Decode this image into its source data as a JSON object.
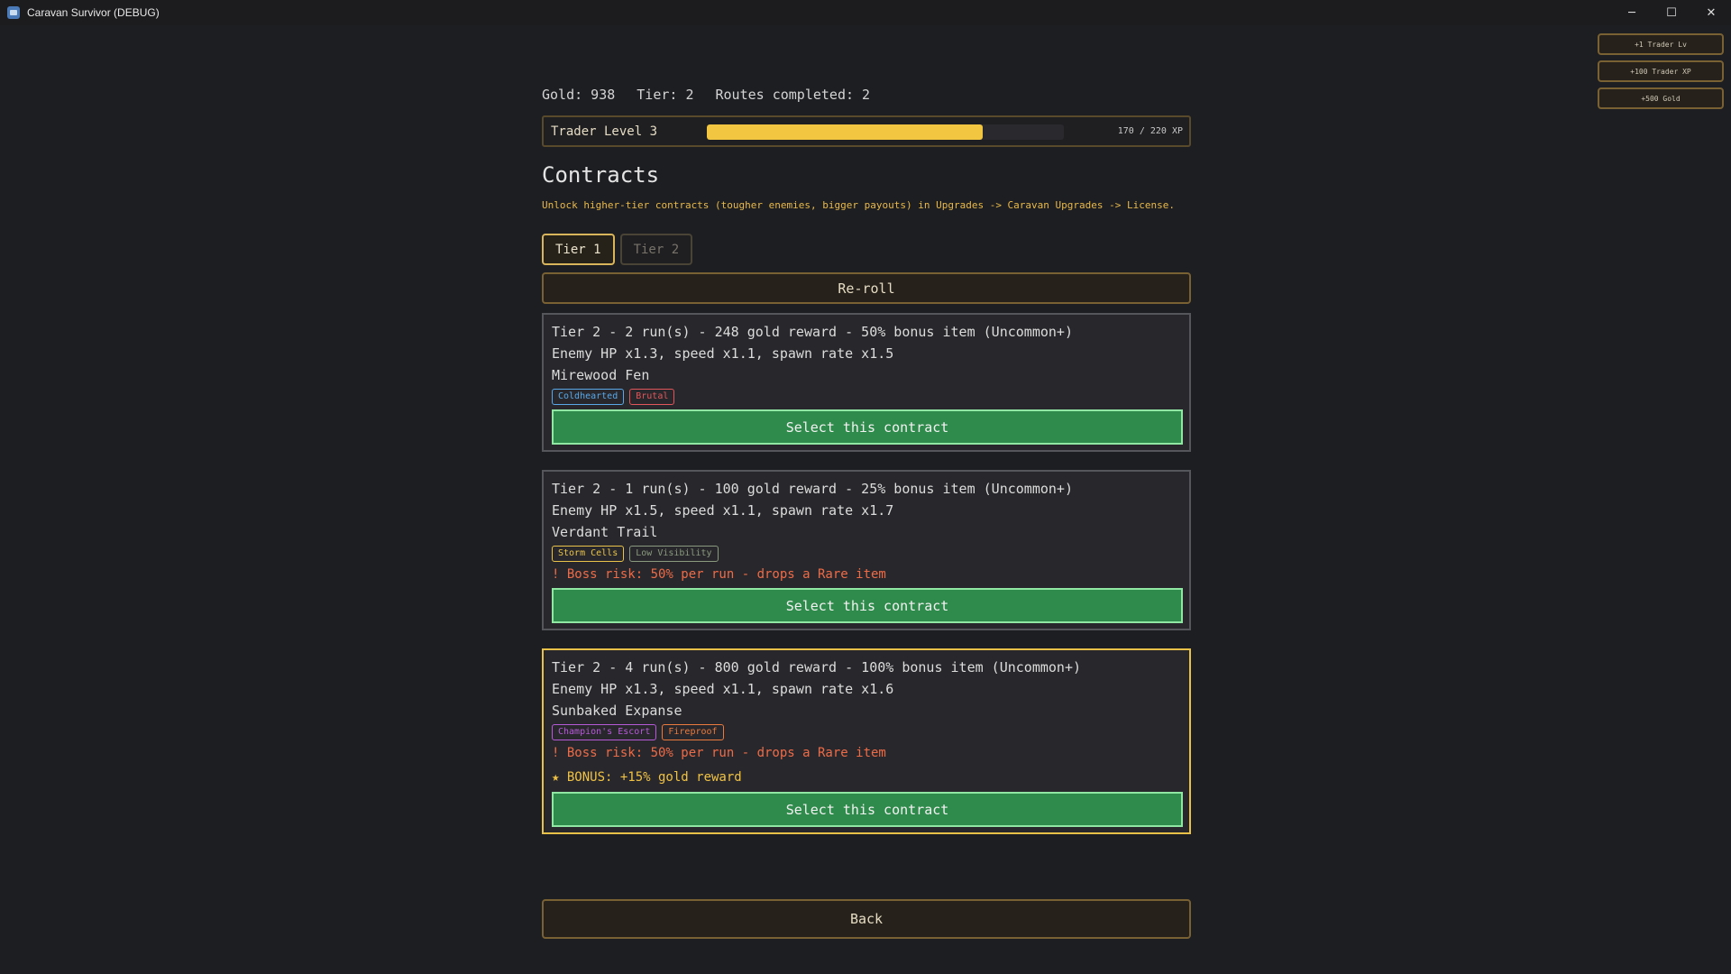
{
  "window": {
    "title": "Caravan Survivor (DEBUG)",
    "controls": {
      "minimize": "─",
      "maximize": "☐",
      "close": "✕"
    }
  },
  "debug_buttons": [
    "+1 Trader Lv",
    "+100 Trader XP",
    "+500 Gold"
  ],
  "stats": {
    "gold": "Gold: 938",
    "tier": "Tier: 2",
    "routes": "Routes completed: 2"
  },
  "trader": {
    "label": "Trader Level 3",
    "xp_text": "170 / 220 XP",
    "xp_current": 170,
    "xp_max": 220,
    "bar_color": "#f2c640"
  },
  "heading": "Contracts",
  "hint": "Unlock higher-tier contracts (tougher enemies, bigger payouts) in Upgrades -> Caravan Upgrades -> License.",
  "tabs": [
    {
      "label": "Tier 1",
      "active": true
    },
    {
      "label": "Tier 2",
      "active": false
    }
  ],
  "reroll_label": "Re-roll",
  "contracts": [
    {
      "summary": "Tier 2 - 2 run(s) - 248 gold reward - 50% bonus item (Uncommon+)",
      "modifiers": "Enemy HP x1.3, speed x1.1, spawn rate x1.5",
      "location": "Mirewood Fen",
      "tags": [
        {
          "label": "Coldhearted",
          "color": "#5aa8e8"
        },
        {
          "label": "Brutal",
          "color": "#e0565a"
        }
      ],
      "select_label": "Select this contract"
    },
    {
      "summary": "Tier 2 - 1 run(s) - 100 gold reward - 25% bonus item (Uncommon+)",
      "modifiers": "Enemy HP x1.5, speed x1.1, spawn rate x1.7",
      "location": "Verdant Trail",
      "tags": [
        {
          "label": "Storm Cells",
          "color": "#e9c34a"
        },
        {
          "label": "Low Visibility",
          "color": "#8a9a7e"
        }
      ],
      "risk": "! Boss risk: 50% per run - drops a Rare item",
      "select_label": "Select this contract"
    },
    {
      "summary": "Tier 2 - 4 run(s) - 800 gold reward - 100% bonus item (Uncommon+)",
      "modifiers": "Enemy HP x1.3, speed x1.1, spawn rate x1.6",
      "location": "Sunbaked Expanse",
      "tags": [
        {
          "label": "Champion's Escort",
          "color": "#b65ad8"
        },
        {
          "label": "Fireproof",
          "color": "#ea7a3e"
        }
      ],
      "risk": "! Boss risk: 50% per run - drops a Rare item",
      "bonus": "★ BONUS: +15% gold reward",
      "select_label": "Select this contract"
    }
  ],
  "back_label": "Back"
}
